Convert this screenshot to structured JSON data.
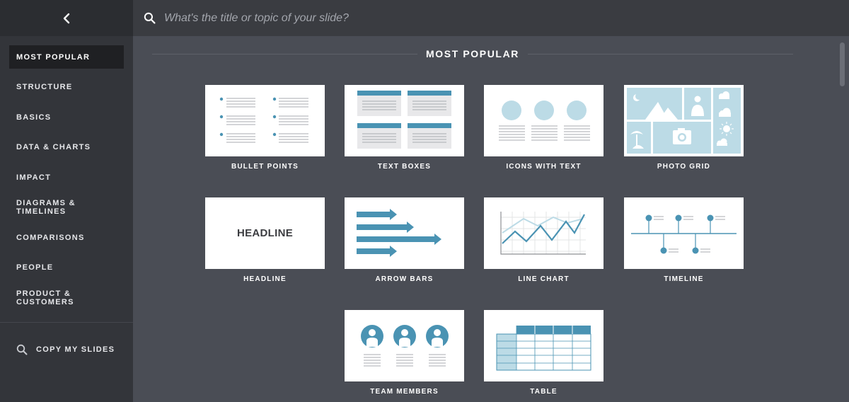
{
  "sidebar": {
    "back_icon": "chevron-left-icon",
    "items": [
      {
        "label": "MOST POPULAR",
        "active": true
      },
      {
        "label": "STRUCTURE"
      },
      {
        "label": "BASICS"
      },
      {
        "label": "DATA & CHARTS"
      },
      {
        "label": "IMPACT"
      },
      {
        "label": "DIAGRAMS & TIMELINES"
      },
      {
        "label": "COMPARISONS"
      },
      {
        "label": "PEOPLE"
      },
      {
        "label": "PRODUCT & CUSTOMERS"
      }
    ],
    "copy_my_slides": {
      "label": "COPY MY SLIDES",
      "icon": "search-icon"
    }
  },
  "search": {
    "placeholder": "What's the title or topic of your slide?",
    "icon": "search-icon"
  },
  "main": {
    "section_title": "MOST POPULAR",
    "templates": [
      {
        "label": "BULLET POINTS"
      },
      {
        "label": "TEXT BOXES"
      },
      {
        "label": "ICONS WITH TEXT"
      },
      {
        "label": "PHOTO GRID"
      },
      {
        "label": "HEADLINE",
        "thumb_text": "HEADLINE"
      },
      {
        "label": "ARROW BARS"
      },
      {
        "label": "LINE CHART"
      },
      {
        "label": "TIMELINE"
      },
      {
        "label": "TEAM MEMBERS"
      },
      {
        "label": "TABLE"
      }
    ]
  },
  "colors": {
    "accent": "#4a93b3",
    "light_accent": "#bcdbe6",
    "sidebar_bg": "#33353a",
    "main_bg": "#4a4d55"
  }
}
